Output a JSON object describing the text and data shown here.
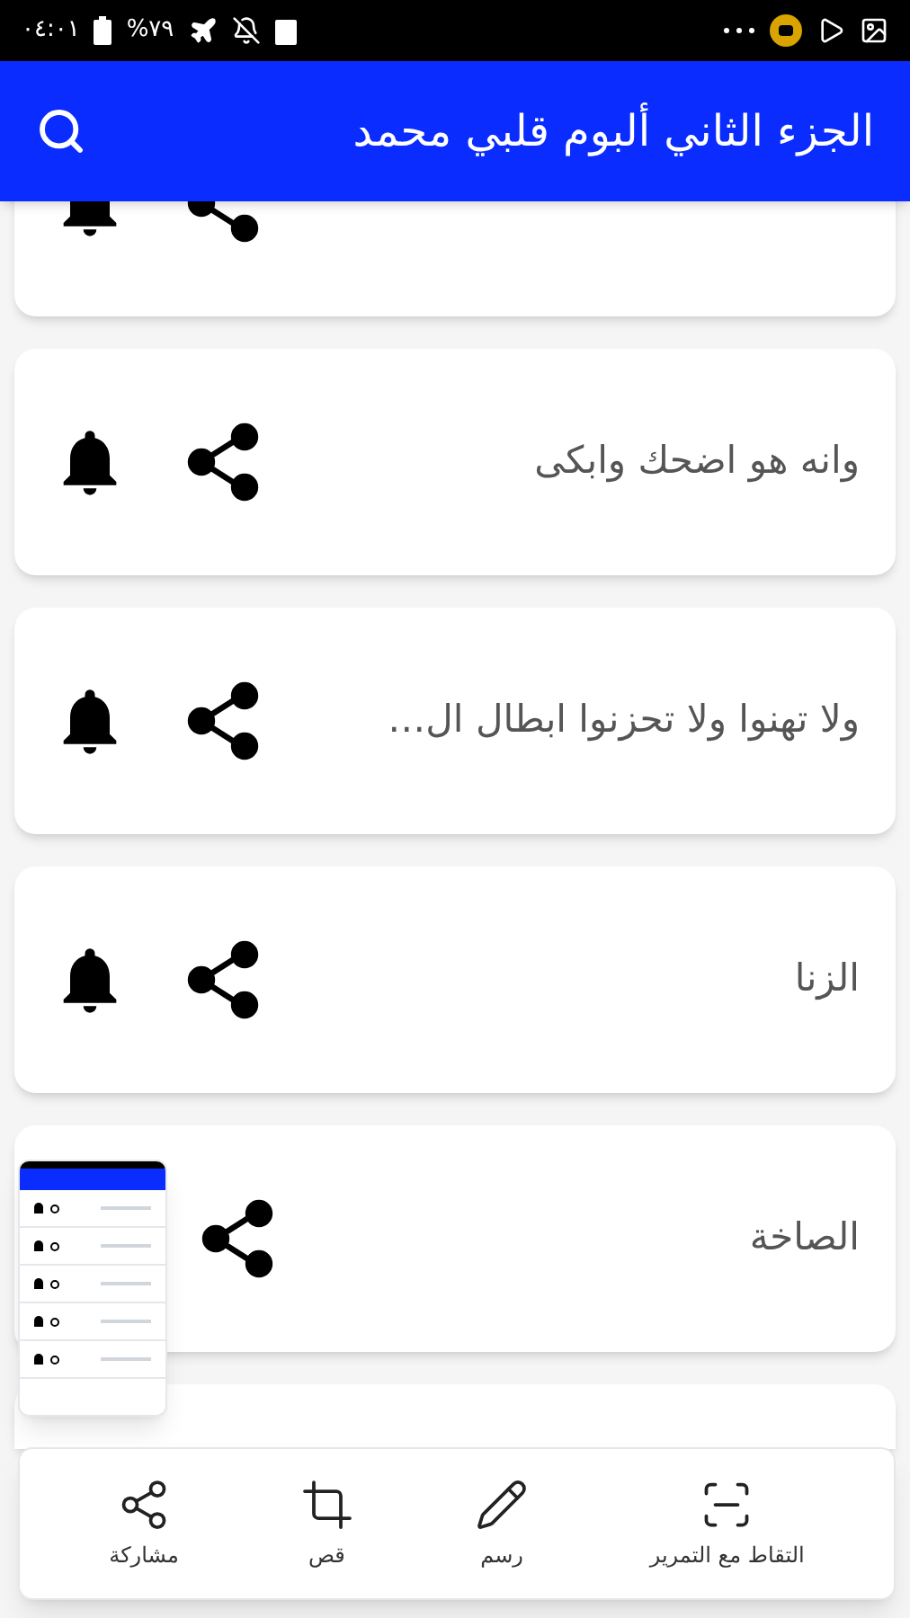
{
  "status_bar": {
    "time": "٠٤:٠١",
    "battery": "%٧٩"
  },
  "app_bar": {
    "title": "الجزء الثاني ألبوم قلبي محمد"
  },
  "items": [
    {
      "kind": "cut_top"
    },
    {
      "kind": "song",
      "title": "وانه هو اضحك وابكى"
    },
    {
      "kind": "song",
      "title": "ولا تهنوا ولا تحزنوا ابطال ال…"
    },
    {
      "kind": "song",
      "title": "الزنا"
    },
    {
      "kind": "song",
      "title": "الصاخة"
    },
    {
      "kind": "covered"
    }
  ],
  "screenshot_toolbar": {
    "actions": [
      {
        "kind": "scroll",
        "label": "التقاط مع التمرير"
      },
      {
        "kind": "draw",
        "label": "رسم"
      },
      {
        "kind": "crop",
        "label": "قص"
      },
      {
        "kind": "share",
        "label": "مشاركة"
      }
    ]
  }
}
